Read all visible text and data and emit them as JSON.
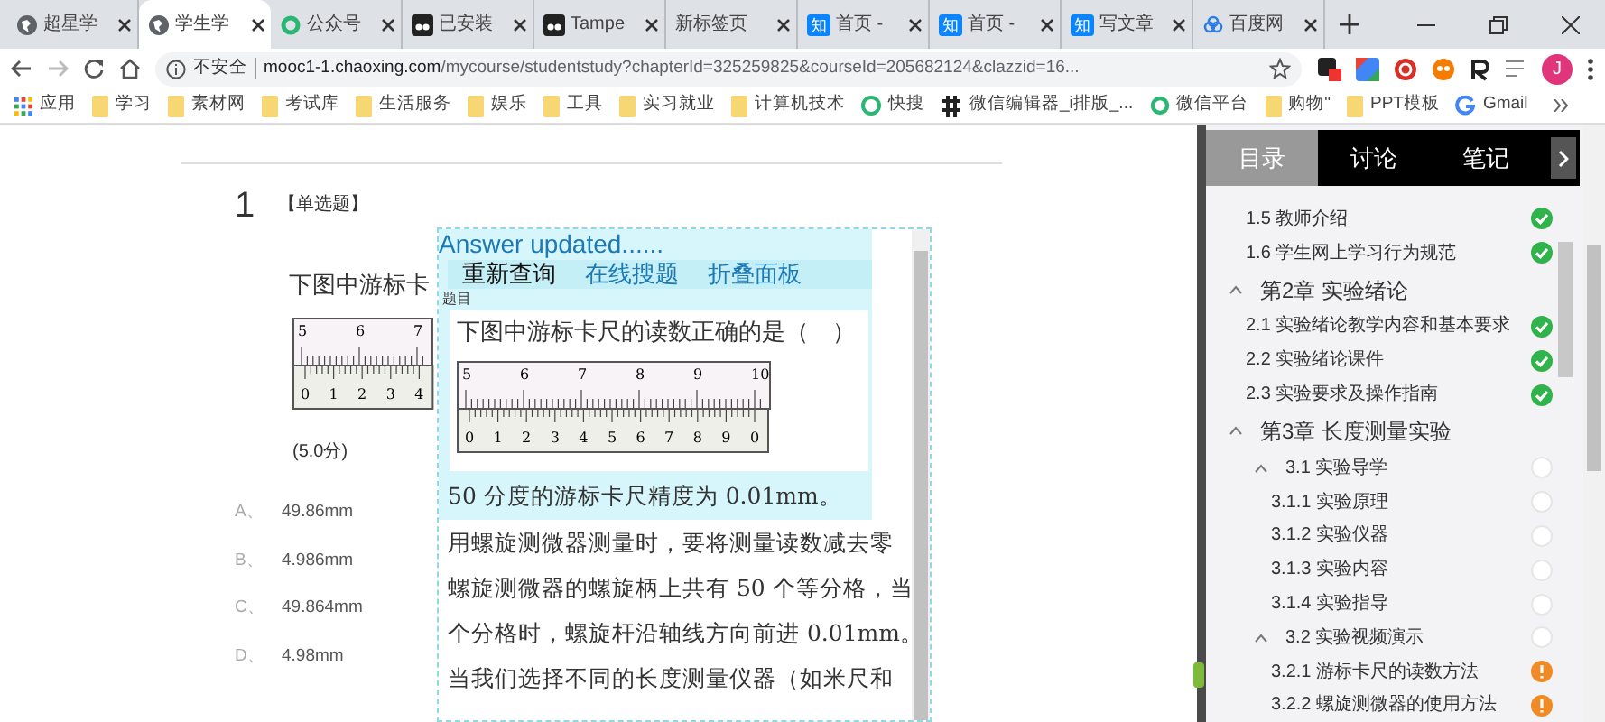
{
  "browser": {
    "tabs": [
      {
        "title": "超星学",
        "kind": "globe",
        "selected": false
      },
      {
        "title": "学生学",
        "kind": "globe",
        "selected": true
      },
      {
        "title": "公众号",
        "kind": "ring",
        "selected": false
      },
      {
        "title": "已安装",
        "kind": "monkey",
        "selected": false
      },
      {
        "title": "Tampe",
        "kind": "monkey",
        "selected": false
      },
      {
        "title": "新标签页",
        "kind": "plain",
        "selected": false
      },
      {
        "title": "首页 -",
        "kind": "logo",
        "logo": "知",
        "selected": false
      },
      {
        "title": "首页 -",
        "kind": "logo",
        "logo": "知",
        "selected": false
      },
      {
        "title": "写文章",
        "kind": "logo",
        "logo": "知",
        "selected": false
      },
      {
        "title": "百度网",
        "kind": "cloud",
        "selected": false
      }
    ],
    "address": {
      "security": "不安全",
      "host": "mooc1-1.chaoxing.com",
      "path": "/mycourse/studentstudy?chapterId=325259825&courseId=205682124&clazzid=16..."
    },
    "avatar": "J",
    "bookmarks": [
      {
        "label": "应用",
        "kind": "apps"
      },
      {
        "label": "学习",
        "kind": "folder"
      },
      {
        "label": "素材网",
        "kind": "folder"
      },
      {
        "label": "考试库",
        "kind": "folder"
      },
      {
        "label": "生活服务",
        "kind": "folder"
      },
      {
        "label": "娱乐",
        "kind": "folder"
      },
      {
        "label": "工具",
        "kind": "folder"
      },
      {
        "label": "实习就业",
        "kind": "folder"
      },
      {
        "label": "计算机技术",
        "kind": "folder"
      },
      {
        "label": "快搜",
        "kind": "dot"
      },
      {
        "label": "微信编辑器_i排版_...",
        "kind": "bars"
      },
      {
        "label": "微信平台",
        "kind": "ring"
      },
      {
        "label": "购物\"",
        "kind": "folder"
      },
      {
        "label": "PPT模板",
        "kind": "folder"
      },
      {
        "label": "Gmail",
        "kind": "g"
      }
    ]
  },
  "question": {
    "number": "1",
    "type": "【单选题】",
    "text": "下图中游标卡",
    "ruler": {
      "main": [
        "5",
        "6",
        "7"
      ],
      "vernier": [
        "0",
        "1",
        "2",
        "3",
        "4"
      ]
    },
    "score": "(5.0分)",
    "options": [
      {
        "letter": "A、",
        "text": "49.86mm"
      },
      {
        "letter": "B、",
        "text": "4.986mm"
      },
      {
        "letter": "C、",
        "text": "49.864mm"
      },
      {
        "letter": "D、",
        "text": "4.98mm"
      }
    ]
  },
  "answer_panel": {
    "status": "Answer updated......",
    "buttons": [
      "重新查询",
      "在线搜题",
      "折叠面板"
    ],
    "section_label": "题目",
    "question": "下图中游标卡尺的读数正确的是（　）",
    "ruler": {
      "main": [
        "5",
        "6",
        "7",
        "8",
        "9",
        "10"
      ],
      "vernier": [
        "0",
        "1",
        "2",
        "3",
        "4",
        "5",
        "6",
        "7",
        "8",
        "9",
        "0"
      ]
    },
    "highlight": "50 分度的游标卡尺精度为 0.01mm。",
    "lines": [
      "用螺旋测微器测量时，要将测量读数减去零",
      "螺旋测微器的螺旋柄上共有 50 个等分格，当",
      "个分格时，螺旋杆沿轴线方向前进 0.01mm。",
      "当我们选择不同的长度测量仪器（如米尺和"
    ]
  },
  "sidebar": {
    "tabs": [
      {
        "label": "目录",
        "selected": true
      },
      {
        "label": "讨论",
        "selected": false
      },
      {
        "label": "笔记",
        "selected": false
      }
    ],
    "items": [
      {
        "label": "1.5 教师介绍",
        "done": true
      },
      {
        "label": "1.6 学生网上学习行为规范",
        "done": true
      },
      {
        "label": "第2章 实验绪论",
        "expanded": true,
        "children": [
          {
            "label": "2.1 实验绪论教学内容和基本要求",
            "done": true
          },
          {
            "label": "2.2 实验绪论课件",
            "done": true
          },
          {
            "label": "2.3 实验要求及操作指南",
            "done": true
          }
        ]
      },
      {
        "label": "第3章 长度测量实验",
        "expanded": true,
        "children": [
          {
            "label": "3.1 实验导学",
            "done": false,
            "alert": false,
            "expanded": true,
            "children": [
              {
                "label": "3.1.1 实验原理",
                "done": false,
                "alert": false
              },
              {
                "label": "3.1.2 实验仪器",
                "done": false,
                "alert": false
              },
              {
                "label": "3.1.3 实验内容",
                "done": false,
                "alert": false
              },
              {
                "label": "3.1.4 实验指导",
                "done": false,
                "alert": false
              }
            ]
          },
          {
            "label": "3.2 实验视频演示",
            "done": false,
            "alert": false,
            "expanded": true,
            "children": [
              {
                "label": "3.2.1 游标卡尺的读数方法",
                "alert": true
              },
              {
                "label": "3.2.2 螺旋测微器的使用方法",
                "alert": true
              }
            ]
          }
        ]
      }
    ]
  }
}
